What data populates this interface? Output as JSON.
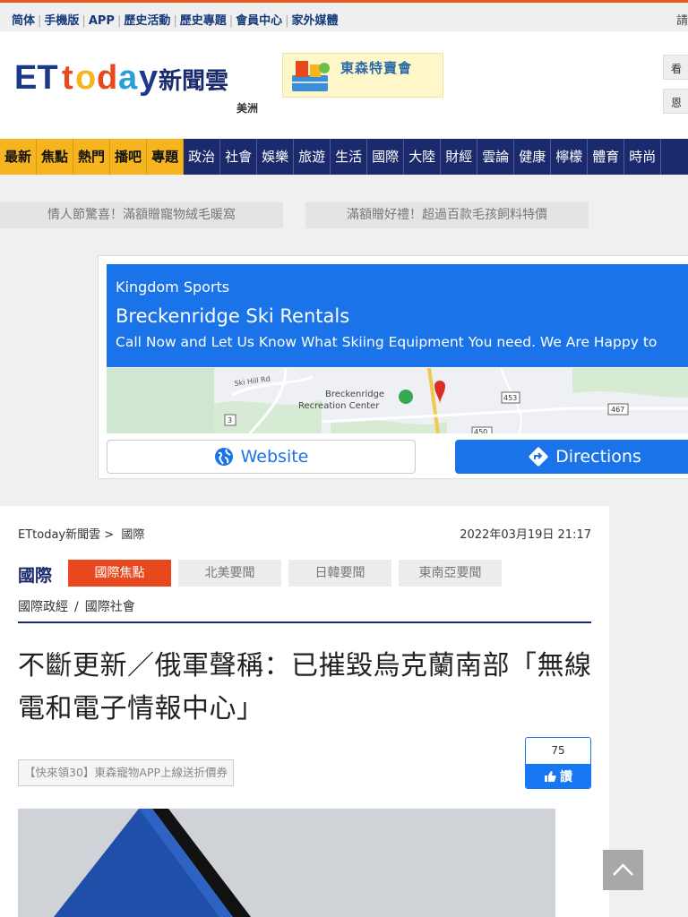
{
  "topbar": {
    "links": [
      "简体",
      "手機版",
      "APP",
      "歷史活動",
      "歷史專題",
      "會員中心",
      "家外媒體"
    ],
    "right_text": "請"
  },
  "header": {
    "logo_text": "ETtoday新聞雲",
    "region": "美洲",
    "banner_text": "東森特賣會",
    "right_buttons": [
      "看",
      "恩"
    ],
    "colors": {
      "orange_accent": "#e85a1d",
      "navy": "#1a2a6c",
      "gold": "#f6b51e"
    }
  },
  "nav": {
    "hot_items": [
      "最新",
      "焦點",
      "熱門",
      "播吧",
      "專題"
    ],
    "items": [
      "政治",
      "社會",
      "娛樂",
      "旅遊",
      "生活",
      "國際",
      "大陸",
      "財經",
      "雲論",
      "健康",
      "檸檬",
      "體育",
      "時尚"
    ]
  },
  "promos": [
    "情人節驚喜！滿額贈寵物絨毛暖窩",
    "滿額贈好禮！超過百款毛孩飼料特價"
  ],
  "ad": {
    "brand": "Kingdom Sports",
    "title": "Breckenridge Ski Rentals",
    "description": "Call Now and Let Us Know What Skiing Equipment You need. We Are Happy to",
    "map": {
      "road_label": "Ski Hill Rd",
      "place_label_1": "Breckenridge",
      "place_label_2": "Recreation Center",
      "route_1": "453",
      "route_2": "467",
      "route_3": "3",
      "route_4": "450"
    },
    "website_label": "Website",
    "directions_label": "Directions"
  },
  "article": {
    "breadcrumb_home": "ETtoday新聞雲",
    "breadcrumb_sep": ">",
    "breadcrumb_section": "國際",
    "date": "2022年03月19日 21:17",
    "section_title": "國際",
    "tabs": [
      "國際焦點",
      "北美要聞",
      "日韓要聞",
      "東南亞要聞"
    ],
    "sub_links": [
      "國際政經",
      "國際社會"
    ],
    "sub_sep": "/",
    "headline": "不斷更新／俄軍聲稱：已摧毀烏克蘭南部「無線電和電子情報中心」",
    "coupon": "【快來領30】東森寵物APP上線送折價券",
    "like_count": "75",
    "like_label": "讚"
  }
}
